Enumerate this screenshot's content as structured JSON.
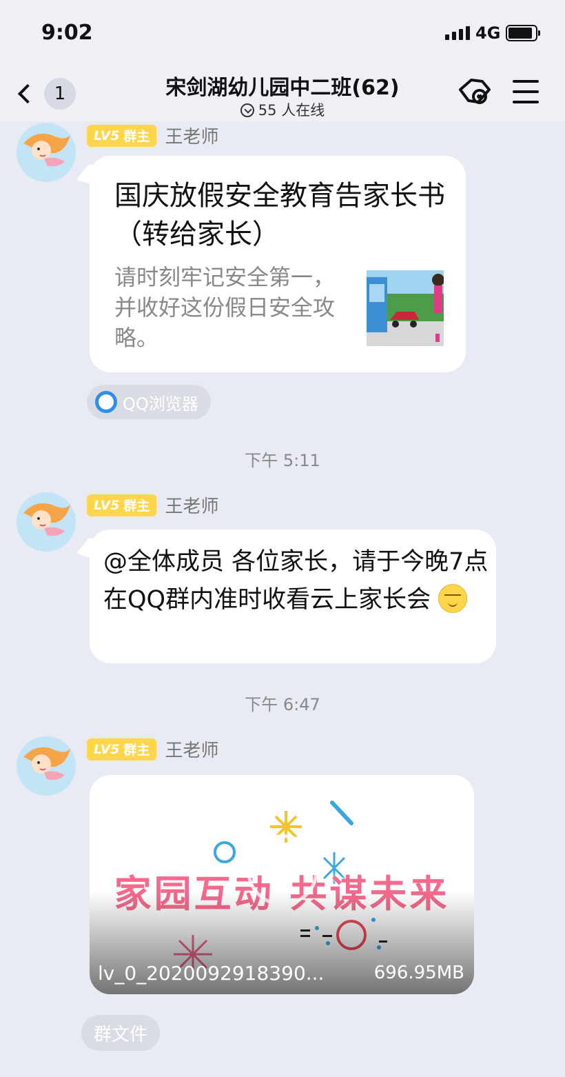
{
  "status_bar": {
    "time": "9:02",
    "network": "4G"
  },
  "nav": {
    "unread_count": "1",
    "title": "宋剑湖幼儿园中二班(62)",
    "online": "55 人在线"
  },
  "messages": [
    {
      "level": "LV5",
      "role": "群主",
      "sender": "王老师",
      "card": {
        "title": "国庆放假安全教育告家长书（转给家长）",
        "description": "请时刻牢记安全第一，并收好这份假日安全攻略。",
        "source": "QQ浏览器"
      }
    },
    {
      "timestamp": "下午 5:11"
    },
    {
      "level": "LV5",
      "role": "群主",
      "sender": "王老师",
      "text": "@全体成员 各位家长，请于今晚7点在QQ群内准时收看云上家长会"
    },
    {
      "timestamp": "下午 6:47"
    },
    {
      "level": "LV5",
      "role": "群主",
      "sender": "王老师",
      "video": {
        "overlay_text": "家园互动 共谋未来",
        "file_name": "lv_0_2020092918390...",
        "file_size": "696.95MB",
        "source": "群文件"
      }
    }
  ],
  "colors": {
    "badge": "#ffd64a",
    "background": "#e8ebf3",
    "overlay_text": "#f56a8c"
  }
}
